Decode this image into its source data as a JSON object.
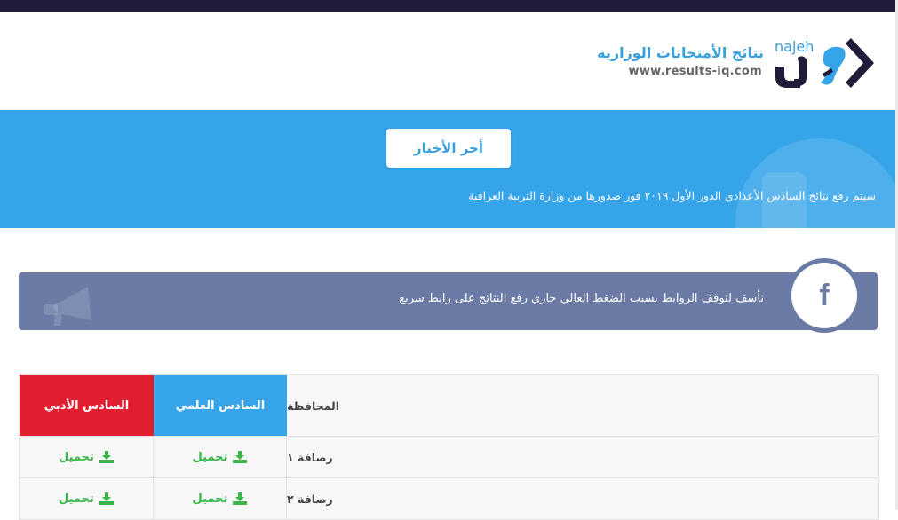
{
  "header": {
    "brand_en": "najeh",
    "site_title": "نتائج الأمتحانات الوزارية",
    "site_url": "www.results-iq.com"
  },
  "news": {
    "button_label": "أخر الأخبار",
    "ticker_text": "سيتم رفع نتائج السادس الأعدادي الدور الأول ٢٠١٩ فور صدورها من وزارة التربية العراقية"
  },
  "alert": {
    "text": "نأسف لتوقف الروابط بسبب الضغط العالي جاري رفع النتائج على رابط سريع",
    "social_icon": "f"
  },
  "table": {
    "headers": {
      "governorate": "المحافظة",
      "scientific": "السادس العلمي",
      "literary": "السادس الأدبي"
    },
    "rows": [
      {
        "governorate": "رصافة ١",
        "scientific": "تحميل",
        "literary": "تحميل"
      },
      {
        "governorate": "رصافة ٢",
        "scientific": "تحميل",
        "literary": "تحميل"
      }
    ]
  },
  "colors": {
    "accent_blue": "#35a4e9",
    "literary_red": "#e21f30",
    "alert_slate": "#6b7ba6",
    "download_green": "#3bb54a",
    "topbar_navy": "#1f1d3a"
  },
  "icons": [
    "najeh-logo-icon",
    "facebook-icon",
    "megaphone-icon",
    "download-icon"
  ]
}
